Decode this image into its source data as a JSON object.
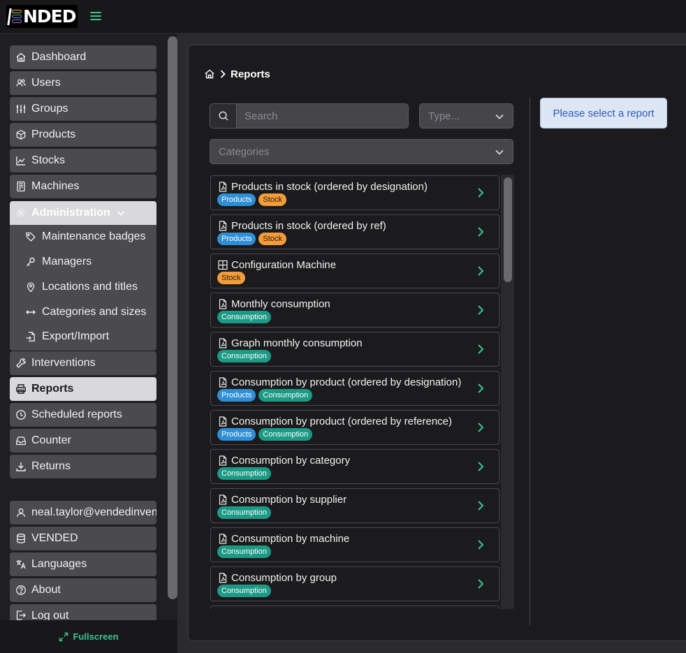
{
  "app": {
    "logo_text": "NDED"
  },
  "sidebar": {
    "items_top": [
      {
        "label": "Dashboard"
      },
      {
        "label": "Users"
      },
      {
        "label": "Groups"
      },
      {
        "label": "Products"
      },
      {
        "label": "Stocks"
      },
      {
        "label": "Machines"
      }
    ],
    "admin": {
      "label": "Administration",
      "children": [
        {
          "label": "Maintenance badges"
        },
        {
          "label": "Managers"
        },
        {
          "label": "Locations and titles"
        },
        {
          "label": "Categories and sizes"
        },
        {
          "label": "Export/Import"
        }
      ]
    },
    "items_bottom": [
      {
        "label": "Interventions"
      },
      {
        "label": "Reports"
      },
      {
        "label": "Scheduled reports"
      },
      {
        "label": "Counter"
      },
      {
        "label": "Returns"
      }
    ],
    "account": [
      {
        "label": "neal.taylor@vendedinventory.com"
      },
      {
        "label": "VENDED"
      },
      {
        "label": "Languages"
      },
      {
        "label": "About"
      },
      {
        "label": "Log out"
      }
    ],
    "fullscreen_label": "Fullscreen"
  },
  "main": {
    "breadcrumb": {
      "current": "Reports"
    },
    "search": {
      "value": "",
      "placeholder": "Search"
    },
    "type_select": {
      "value": "Type..."
    },
    "categories_select": {
      "value": "Categories"
    },
    "info_message": "Please select a report",
    "tags": {
      "products": "Products",
      "stock": "Stock",
      "consumption": "Consumption"
    },
    "reports": [
      {
        "title": "Products in stock (ordered by designation)",
        "icon": "pdf-file-icon",
        "tags": [
          "products",
          "stock"
        ]
      },
      {
        "title": "Products in stock (ordered by ref)",
        "icon": "pdf-file-icon",
        "tags": [
          "products",
          "stock"
        ]
      },
      {
        "title": "Configuration Machine",
        "icon": "grid-icon",
        "tags": [
          "stock"
        ]
      },
      {
        "title": "Monthly consumption",
        "icon": "pdf-file-icon",
        "tags": [
          "consumption"
        ]
      },
      {
        "title": "Graph monthly consumption",
        "icon": "pdf-file-icon",
        "tags": [
          "consumption"
        ]
      },
      {
        "title": "Consumption by product (ordered by designation)",
        "icon": "pdf-file-icon",
        "tags": [
          "products",
          "consumption"
        ]
      },
      {
        "title": "Consumption by product (ordered by reference)",
        "icon": "pdf-file-icon",
        "tags": [
          "products",
          "consumption"
        ]
      },
      {
        "title": "Consumption by category",
        "icon": "pdf-file-icon",
        "tags": [
          "consumption"
        ]
      },
      {
        "title": "Consumption by supplier",
        "icon": "pdf-file-icon",
        "tags": [
          "consumption"
        ]
      },
      {
        "title": "Consumption by machine",
        "icon": "pdf-file-icon",
        "tags": [
          "consumption"
        ]
      },
      {
        "title": "Consumption by group",
        "icon": "pdf-file-icon",
        "tags": [
          "consumption"
        ]
      }
    ]
  },
  "colors": {
    "accent": "#3cc48f",
    "tag_products": "#2f8fd6",
    "tag_stock": "#f39c3c",
    "tag_consumption": "#1c9a86",
    "info_text": "#2e5bb8"
  }
}
